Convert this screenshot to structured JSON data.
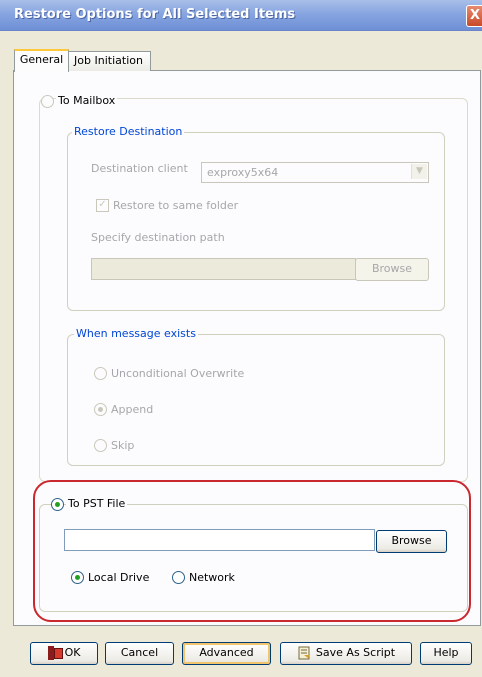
{
  "window": {
    "title": "Restore Options for All Selected Items",
    "close_glyph": "X"
  },
  "tabs": [
    {
      "label": "General"
    },
    {
      "label": "Job Initiation"
    }
  ],
  "to_mailbox": {
    "label": "To Mailbox",
    "restore_destination": {
      "title": "Restore Destination",
      "destination_client_label": "Destination client",
      "destination_client_value": "exproxy5x64",
      "restore_same_folder_label": "Restore to same folder",
      "specify_path_label": "Specify destination path",
      "path_value": "",
      "browse_label": "Browse"
    },
    "when_message_exists": {
      "title": "When message exists",
      "options": [
        {
          "label": "Unconditional Overwrite"
        },
        {
          "label": "Append"
        },
        {
          "label": "Skip"
        }
      ]
    }
  },
  "to_pst": {
    "label": "To PST File",
    "path_value": "",
    "browse_label": "Browse",
    "local_drive_label": "Local Drive",
    "network_label": "Network"
  },
  "footer": {
    "ok_label": "OK",
    "cancel_label": "Cancel",
    "advanced_label": "Advanced",
    "save_script_label": "Save As Script",
    "help_label": "Help"
  },
  "colors": {
    "highlight": "#c8282e",
    "group_title": "#0046d5",
    "radio_selected": "#21a121"
  }
}
